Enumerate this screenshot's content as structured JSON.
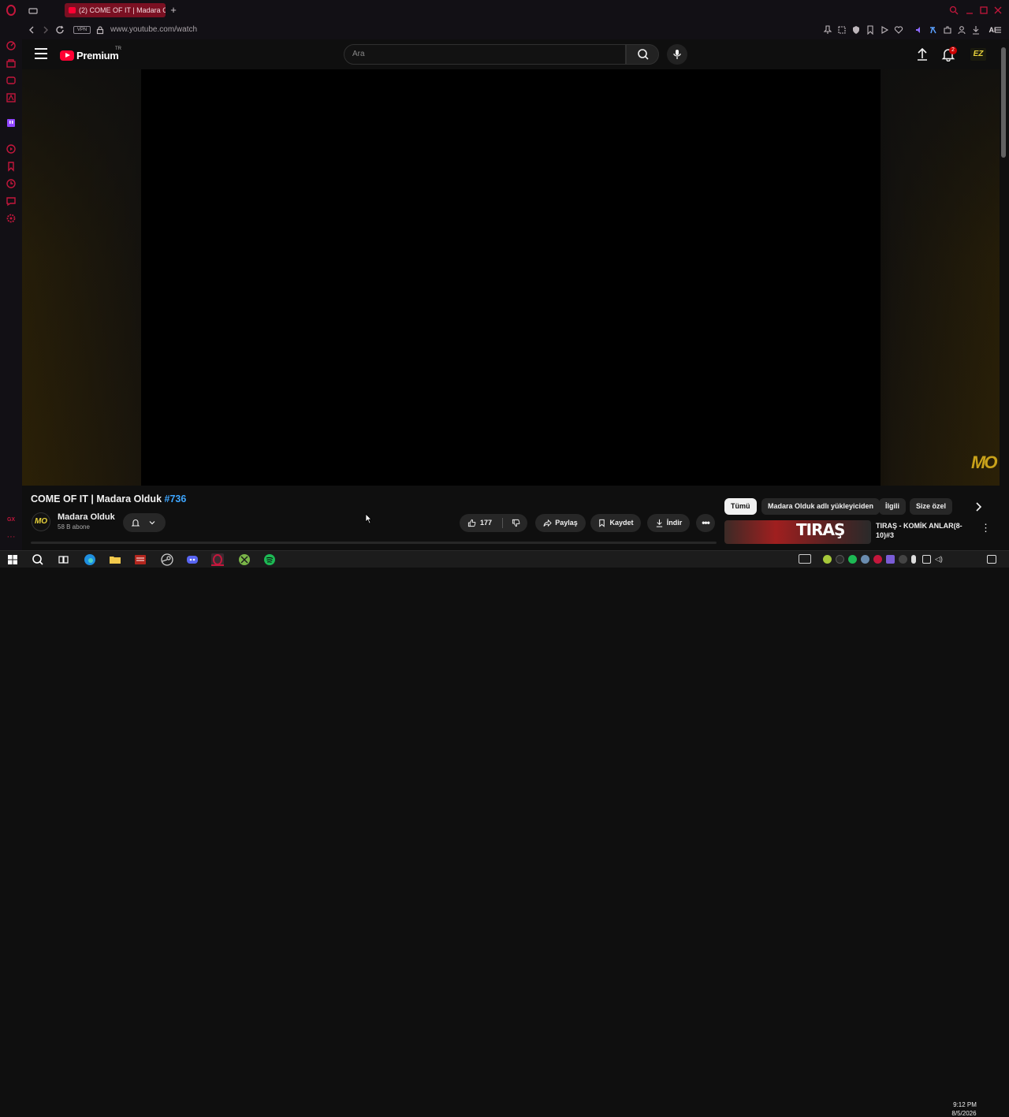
{
  "browser": {
    "tab_title": "(2) COME OF IT | Madara O",
    "url": "www.youtube.com/watch",
    "vpn_label": "VPN",
    "ai_label": "AI",
    "gx_label": "GX"
  },
  "header": {
    "logo_text": "Premium",
    "region": "TR",
    "search_placeholder": "Ara",
    "notification_count": "2",
    "avatar_text": "EZ"
  },
  "video": {
    "title": "COME OF IT | Madara Olduk ",
    "hashtag": "#736",
    "watermark": "MO",
    "channel_avatar_text": "MO",
    "channel_name": "Madara Olduk",
    "subscribers": "58 B abone",
    "likes": "177",
    "share_label": "Paylaş",
    "save_label": "Kaydet",
    "download_label": "İndir"
  },
  "chips": [
    "Tümü",
    "Madara Olduk adlı yükleyiciden",
    "İlgili",
    "Size özel"
  ],
  "recommendation": {
    "thumb_text": "TIRAŞ",
    "title": "TIRAŞ - KOMİK ANLAR(8-10)#3"
  },
  "taskbar": {
    "time": "9:12 PM",
    "date": "8/5/2026"
  },
  "colors": {
    "accent_gx": "#c4173c",
    "yt_red": "#ff0033",
    "hashtag_blue": "#3ea6ff"
  }
}
